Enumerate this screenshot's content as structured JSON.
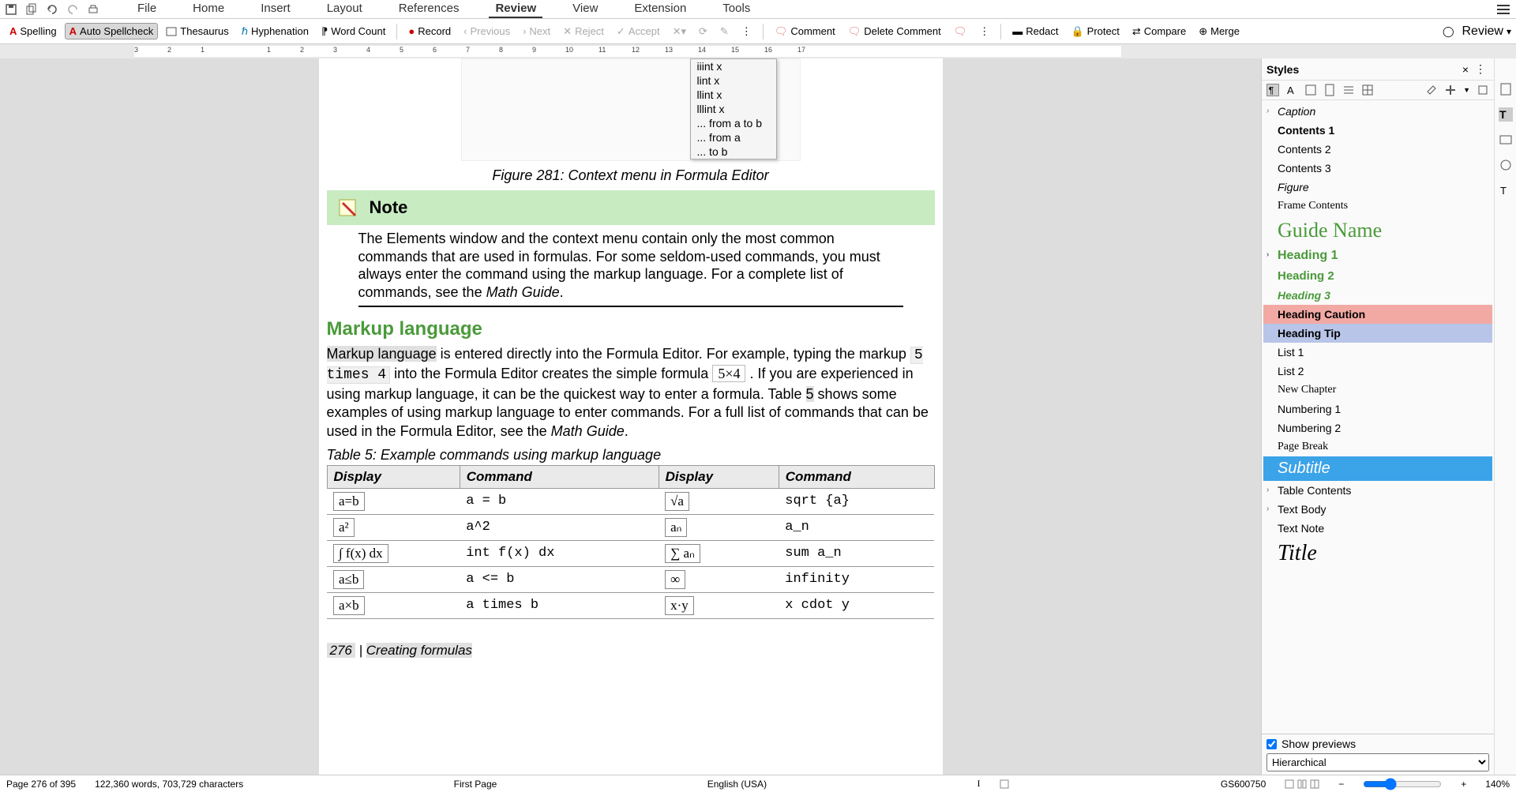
{
  "menu": {
    "tabs": [
      "File",
      "Home",
      "Insert",
      "Layout",
      "References",
      "Review",
      "View",
      "Extension",
      "Tools"
    ],
    "active": "Review"
  },
  "toolbar": {
    "spelling": "Spelling",
    "auto_spellcheck": "Auto Spellcheck",
    "thesaurus": "Thesaurus",
    "hyphenation": "Hyphenation",
    "word_count": "Word Count",
    "record": "Record",
    "previous": "Previous",
    "next": "Next",
    "reject": "Reject",
    "accept": "Accept",
    "comment": "Comment",
    "delete_comment": "Delete Comment",
    "redact": "Redact",
    "protect": "Protect",
    "compare": "Compare",
    "merge": "Merge",
    "review": "Review"
  },
  "ruler_numbers": [
    "3",
    "2",
    "1",
    "",
    "1",
    "2",
    "3",
    "4",
    "5",
    "6",
    "7",
    "8",
    "9",
    "10",
    "11",
    "12",
    "13",
    "14",
    "15",
    "16",
    "17"
  ],
  "context_menu": [
    "iiint x",
    "lint x",
    "llint x",
    "lllint x",
    "... from a to b",
    "... from a",
    "... to b"
  ],
  "fig_caption": "Figure 281: Context menu in Formula Editor",
  "note": {
    "title": "Note",
    "body_pre": "The Elements window and the context menu contain only the most common commands that are used in formulas. For some seldom-used commands, you must always enter the command using the markup language. For a complete list of commands, see the ",
    "guide": "Math Guide",
    "body_post": "."
  },
  "h2": "Markup language",
  "body": {
    "p1a": "Markup language",
    "p1b": " is entered directly into the Formula Editor. For example, typing the markup ",
    "code1": "5 times 4",
    "p1c": " into the Formula Editor creates the simple formula ",
    "formula1": "5×4",
    "p1d": " . If you are experienced in using markup language, it can be the quickest way to enter a formula. Table ",
    "tnum": "5",
    "p1e": " shows some examples of using markup language to enter commands. For a full list of commands that can be used in the Formula Editor, see the ",
    "guide": "Math Guide",
    "p1f": "."
  },
  "table_caption": "Table 5: Example commands using markup language",
  "table": {
    "headers": [
      "Display",
      "Command",
      "Display",
      "Command"
    ],
    "rows": [
      {
        "d1": "a=b",
        "c1": "a = b",
        "d2": "√a",
        "c2": "sqrt {a}"
      },
      {
        "d1": "a²",
        "c1": "a^2",
        "d2": "aₙ",
        "c2": "a_n"
      },
      {
        "d1": "∫ f(x) dx",
        "c1": "int f(x) dx",
        "d2": "∑ aₙ",
        "c2": "sum a_n"
      },
      {
        "d1": "a≤b",
        "c1": "a <= b",
        "d2": "∞",
        "c2": "infinity"
      },
      {
        "d1": "a×b",
        "c1": "a times b",
        "d2": "x·y",
        "c2": "x cdot y"
      }
    ]
  },
  "page_footer": {
    "num": "276",
    "sep": " | ",
    "title": "Creating formulas"
  },
  "sidepanel": {
    "title": "Styles",
    "styles": [
      {
        "name": "Caption",
        "cls": "s-italic",
        "chev": true
      },
      {
        "name": "Contents 1",
        "cls": "",
        "bold": true
      },
      {
        "name": "Contents 2",
        "cls": ""
      },
      {
        "name": "Contents 3",
        "cls": ""
      },
      {
        "name": "Figure",
        "cls": "s-italic"
      },
      {
        "name": "Frame Contents",
        "cls": "s-serif"
      },
      {
        "name": "Guide Name",
        "cls": "s-guide"
      },
      {
        "name": "Heading 1",
        "cls": "s-bold-green",
        "chev": true
      },
      {
        "name": "Heading 2",
        "cls": "s-bold-green2"
      },
      {
        "name": "Heading 3",
        "cls": "s-italic-green"
      },
      {
        "name": "Heading Caution",
        "cls": "s-caution"
      },
      {
        "name": "Heading Tip",
        "cls": "s-tip"
      },
      {
        "name": "List 1",
        "cls": ""
      },
      {
        "name": "List 2",
        "cls": ""
      },
      {
        "name": "New Chapter",
        "cls": "s-serif"
      },
      {
        "name": "Numbering 1",
        "cls": ""
      },
      {
        "name": "Numbering 2",
        "cls": ""
      },
      {
        "name": "Page Break",
        "cls": "s-serif"
      },
      {
        "name": "Subtitle",
        "cls": "style-selected"
      },
      {
        "name": "Table Contents",
        "cls": "",
        "chev": true
      },
      {
        "name": "Text Body",
        "cls": "",
        "chev": true
      },
      {
        "name": "Text Note",
        "cls": ""
      },
      {
        "name": "Title",
        "cls": "s-title"
      }
    ],
    "show_previews": "Show previews",
    "filter": "Hierarchical"
  },
  "status": {
    "page": "Page 276 of 395",
    "words": "122,360 words, 703,729 characters",
    "style": "First Page",
    "lang": "English (USA)",
    "doc": "GS600750",
    "zoom": "140%"
  }
}
